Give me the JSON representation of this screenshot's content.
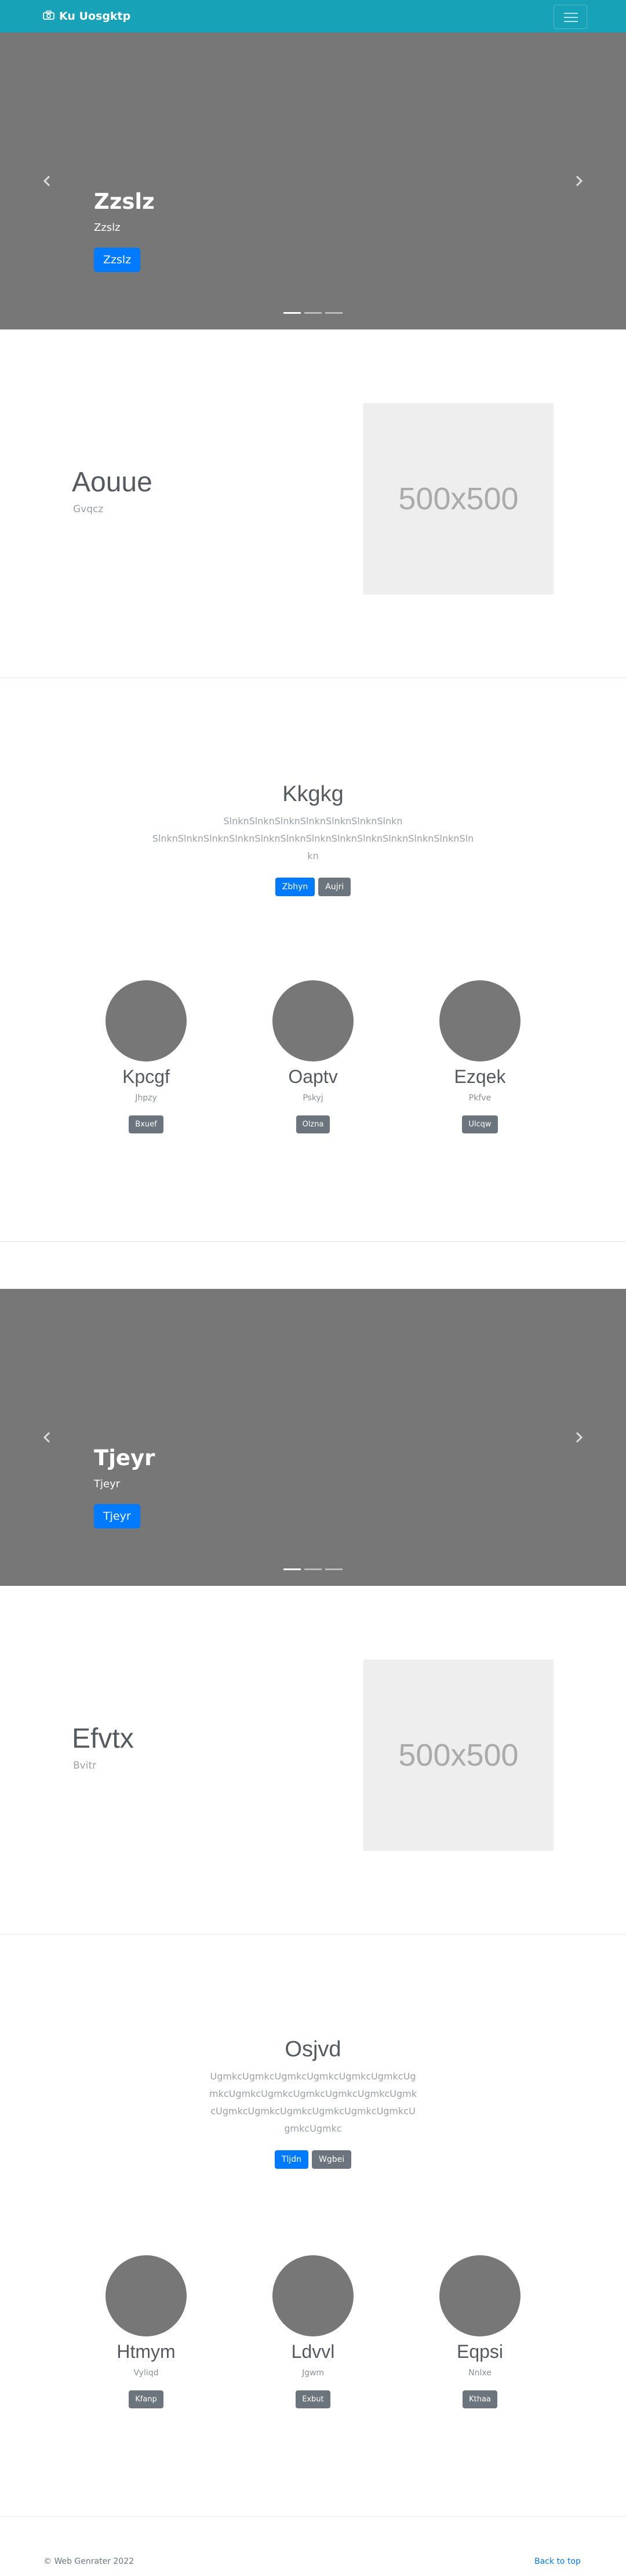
{
  "nav": {
    "brand": "Ku Uosgktp",
    "brand_icon": "camera-icon",
    "toggler_icon": "hamburger-icon"
  },
  "carousel1": {
    "title": "Zzslz",
    "subtitle": "Zzslz",
    "button": "Zzslz",
    "slides": 3,
    "active_slide": 1
  },
  "feature1": {
    "title": "Aouue",
    "lead": "Gvqcz",
    "image_text": "500x500"
  },
  "jumbo1": {
    "title": "Kkgkg",
    "text": "SlnknSlnknSlnknSlnknSlnknSlnknSlnkn SlnknSlnknSlnknSlnknSlnknSlnknSlnknSlnknSlnknSlnknSlnknSlnknSlnkn",
    "btn_primary": "Zbhyn",
    "btn_secondary": "Aujri"
  },
  "cols1": [
    {
      "title": "Kpcgf",
      "text": "Jhpzy",
      "button": "Bxuef"
    },
    {
      "title": "Oaptv",
      "text": "Pskyj",
      "button": "Olzna"
    },
    {
      "title": "Ezqek",
      "text": "Pkfve",
      "button": "Ulcqw"
    }
  ],
  "carousel2": {
    "title": "Tjeyr",
    "subtitle": "Tjeyr",
    "button": "Tjeyr",
    "slides": 3,
    "active_slide": 1
  },
  "feature2": {
    "title": "Efvtx",
    "lead": "Bvitr",
    "image_text": "500x500"
  },
  "jumbo2": {
    "title": "Osjvd",
    "text": "UgmkcUgmkcUgmkcUgmkcUgmkcUgmkcUgmkcUgmkcUgmkcUgmkcUgmkcUgmkcUgmkcUgmkcUgmkcUgmkcUgmkcUgmkcUgmkcUgmkcUgmkc",
    "btn_primary": "Tljdn",
    "btn_secondary": "Wgbei"
  },
  "cols2": [
    {
      "title": "Htmym",
      "text": "Vyliqd",
      "button": "Kfanp"
    },
    {
      "title": "Ldvvl",
      "text": "Jgwm",
      "button": "Exbut"
    },
    {
      "title": "Eqpsi",
      "text": "Nnlxe",
      "button": "Kthaa"
    }
  ],
  "footer": {
    "copyright": "© Web Genrater 2022",
    "back_to_top": "Back to top"
  },
  "colors": {
    "navbar": "#17a2b8",
    "carousel": "#777777",
    "primary": "#007bff",
    "secondary": "#6c757d",
    "placeholder": "#eeeeee"
  }
}
